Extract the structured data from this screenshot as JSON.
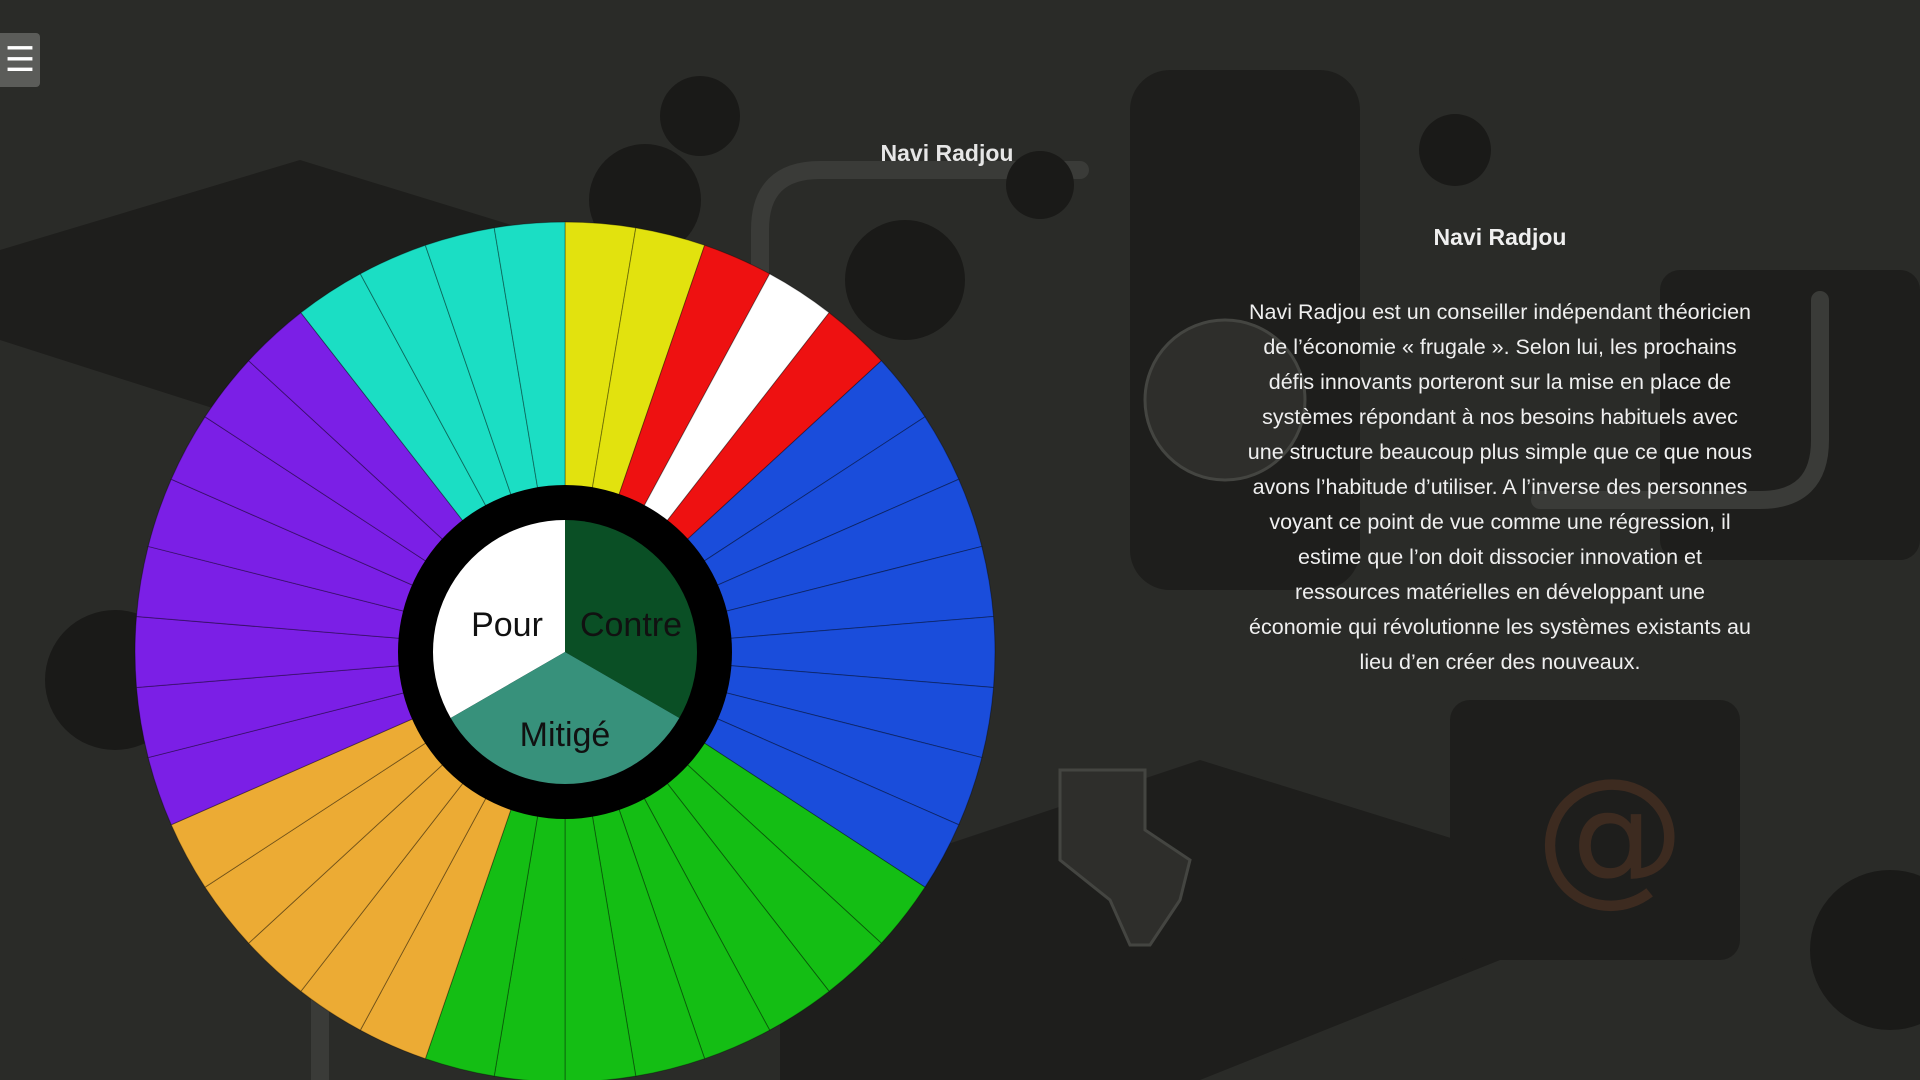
{
  "menu": {
    "icon": "hamburger-menu-icon",
    "glyph": "☰"
  },
  "header": {
    "person_name": "Navi Radjou"
  },
  "info_panel": {
    "title": "Navi Radjou",
    "text": "Navi Radjou est un conseiller indépendant théoricien de l’économie « frugale ». Selon lui, les prochains défis innovants porteront sur la mise en place de systèmes répondant à nos besoins habituels avec une structure beaucoup plus simple que ce que nous avons l’habitude d’utiliser. A l’inverse des personnes voyant ce point de vue comme une régression, il estime que l’on doit dissocier innovation et ressources matérielles en développant une économie qui révolutionne les systèmes existants au lieu d’en créer des nouveaux."
  },
  "opinion_wheel": {
    "inner": [
      {
        "label": "Pour",
        "color": "#ffffff"
      },
      {
        "label": "Contre",
        "color": "#0a4f25"
      },
      {
        "label": "Mitigé",
        "color": "#37917b"
      }
    ],
    "ring_color": "#000000",
    "outer_groups": [
      {
        "color": "#e2e20e",
        "segments": [
          {
            "fill": "#e2e20e"
          },
          {
            "fill": "#e2e20e"
          }
        ]
      },
      {
        "color": "#ee1111",
        "segments": [
          {
            "fill": "#ee1111"
          },
          {
            "fill": "#ffffff"
          },
          {
            "fill": "#ee1111"
          }
        ]
      },
      {
        "color": "#1a4ddb",
        "segments": [
          {
            "fill": "#1a4ddb"
          },
          {
            "fill": "#1a4ddb"
          },
          {
            "fill": "#1a4ddb"
          },
          {
            "fill": "#1a4ddb"
          },
          {
            "fill": "#1a4ddb"
          },
          {
            "fill": "#1a4ddb"
          },
          {
            "fill": "#1a4ddb"
          },
          {
            "fill": "#1a4ddb"
          }
        ]
      },
      {
        "color": "#14be14",
        "segments": [
          {
            "fill": "#14be14"
          },
          {
            "fill": "#14be14"
          },
          {
            "fill": "#14be14"
          },
          {
            "fill": "#14be14"
          },
          {
            "fill": "#14be14"
          },
          {
            "fill": "#14be14"
          },
          {
            "fill": "#14be14"
          },
          {
            "fill": "#14be14"
          }
        ]
      },
      {
        "color": "#ecab34",
        "segments": [
          {
            "fill": "#ecab34"
          },
          {
            "fill": "#ecab34"
          },
          {
            "fill": "#ecab34"
          },
          {
            "fill": "#ecab34"
          },
          {
            "fill": "#ecab34"
          }
        ]
      },
      {
        "color": "#7b1fe6",
        "segments": [
          {
            "fill": "#7b1fe6"
          },
          {
            "fill": "#7b1fe6"
          },
          {
            "fill": "#7b1fe6"
          },
          {
            "fill": "#7b1fe6"
          },
          {
            "fill": "#7b1fe6"
          },
          {
            "fill": "#7b1fe6"
          },
          {
            "fill": "#7b1fe6"
          },
          {
            "fill": "#7b1fe6"
          }
        ]
      },
      {
        "color": "#1bdec4",
        "segments": [
          {
            "fill": "#1bdec4"
          },
          {
            "fill": "#1bdec4"
          },
          {
            "fill": "#1bdec4"
          },
          {
            "fill": "#1bdec4"
          }
        ]
      }
    ]
  }
}
